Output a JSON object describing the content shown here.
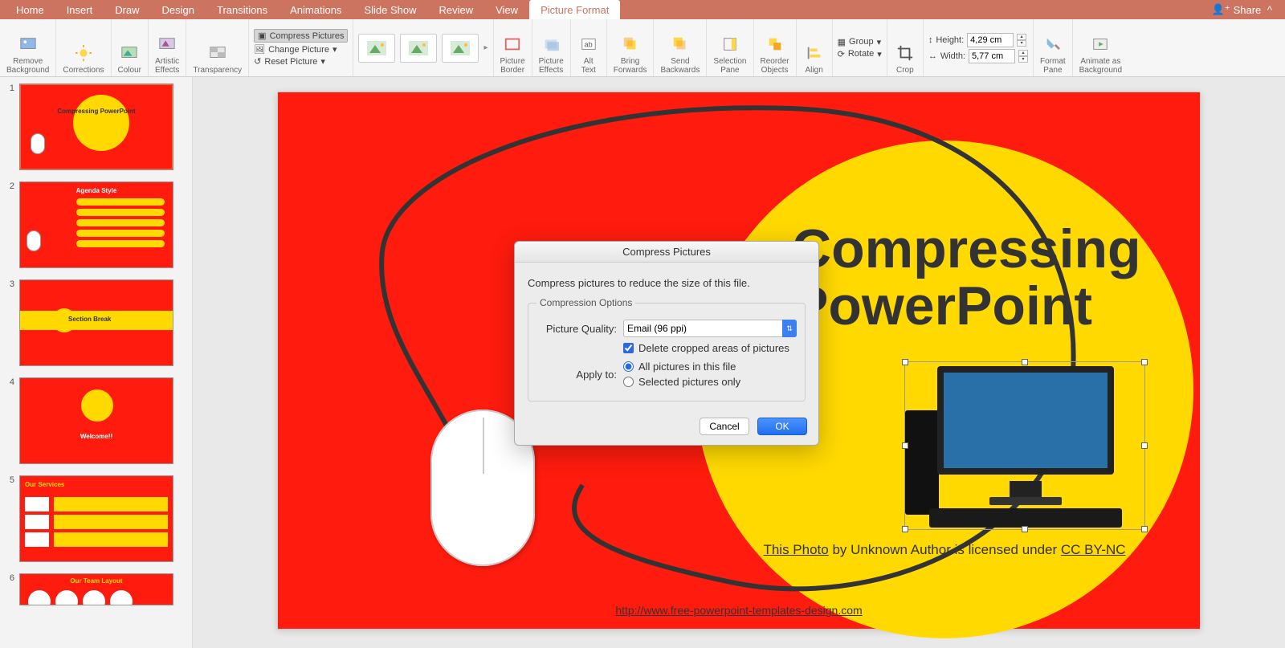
{
  "tabs": {
    "items": [
      "Home",
      "Insert",
      "Draw",
      "Design",
      "Transitions",
      "Animations",
      "Slide Show",
      "Review",
      "View",
      "Picture Format"
    ],
    "activeIndex": 9,
    "share": "Share"
  },
  "ribbon": {
    "removeBg": "Remove\nBackground",
    "corrections": "Corrections",
    "colour": "Colour",
    "artistic": "Artistic\nEffects",
    "transparency": "Transparency",
    "compress": "Compress Pictures",
    "changePic": "Change Picture",
    "resetPic": "Reset Picture",
    "picBorder": "Picture\nBorder",
    "picEffects": "Picture\nEffects",
    "altText": "Alt\nText",
    "bringFwd": "Bring\nForwards",
    "sendBack": "Send\nBackwards",
    "selPane": "Selection\nPane",
    "reorder": "Reorder\nObjects",
    "align": "Align",
    "group": "Group",
    "rotate": "Rotate",
    "crop": "Crop",
    "heightLbl": "Height:",
    "widthLbl": "Width:",
    "heightVal": "4,29 cm",
    "widthVal": "5,77 cm",
    "formatPane": "Format\nPane",
    "animateAsBg": "Animate as\nBackground"
  },
  "thumbs": [
    {
      "n": "1",
      "title": "Compressing PowerPoint"
    },
    {
      "n": "2",
      "title": "Agenda Style"
    },
    {
      "n": "3",
      "title": "Section Break"
    },
    {
      "n": "4",
      "title": "Welcome!!"
    },
    {
      "n": "5",
      "title": "Our Services"
    },
    {
      "n": "6",
      "title": "Our Team Layout"
    }
  ],
  "slide": {
    "title": "Compressing\nPowerPoint",
    "attrib_prefix": "This Photo",
    "attrib_mid": " by Unknown Author is licensed under ",
    "attrib_link": "CC BY-NC",
    "footer_url": "http://www.free-powerpoint-templates-design.com"
  },
  "dialog": {
    "title": "Compress Pictures",
    "subtitle": "Compress pictures to reduce the size of this file.",
    "options_legend": "Compression Options",
    "quality_label": "Picture Quality:",
    "quality_value": "Email (96 ppi)",
    "delete_cropped": "Delete cropped areas of pictures",
    "apply_label": "Apply to:",
    "radio_all": "All pictures in this file",
    "radio_sel": "Selected pictures only",
    "cancel": "Cancel",
    "ok": "OK"
  }
}
